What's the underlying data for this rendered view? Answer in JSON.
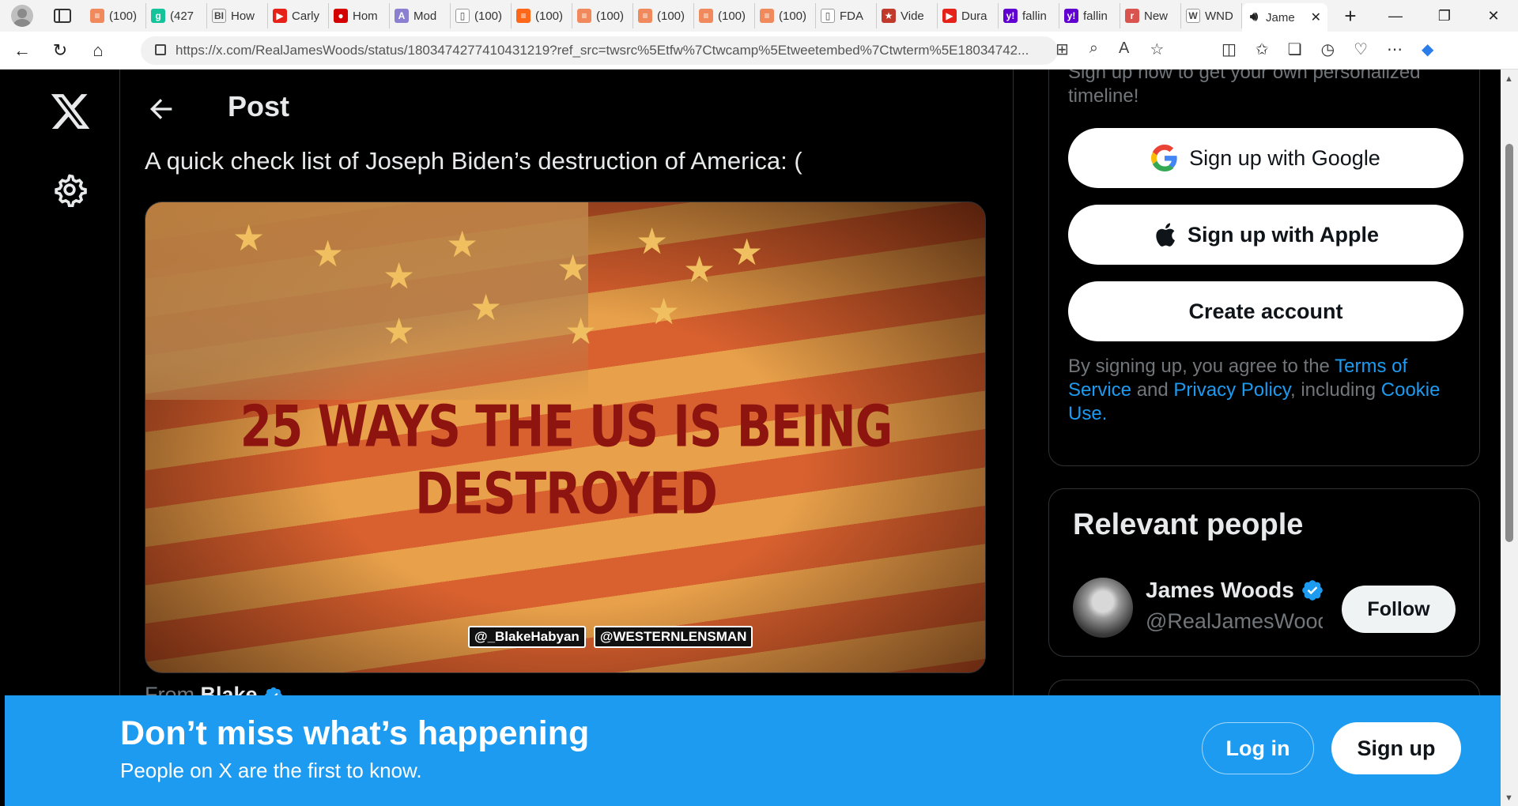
{
  "browser": {
    "tabs": [
      {
        "label": "(100)",
        "icon": "substack-icon",
        "color": "#f08a5d",
        "glyph": "≡"
      },
      {
        "label": "(427",
        "icon": "grammarly-icon",
        "color": "#15c39a",
        "glyph": "g"
      },
      {
        "label": "How",
        "icon": "bi-icon",
        "color": "#f2f2f2",
        "glyph": "BI"
      },
      {
        "label": "Carly",
        "icon": "youtube-icon",
        "color": "#e62117",
        "glyph": "▶"
      },
      {
        "label": "Hom",
        "icon": "red-logo-icon",
        "color": "#d40000",
        "glyph": "●"
      },
      {
        "label": "Mod",
        "icon": "ai-icon",
        "color": "#8a7fd0",
        "glyph": "A"
      },
      {
        "label": "(100)",
        "icon": "page-icon",
        "color": "#ffffff",
        "glyph": "▯"
      },
      {
        "label": "(100)",
        "icon": "substack-icon",
        "color": "#ff6719",
        "glyph": "≡"
      },
      {
        "label": "(100)",
        "icon": "substack-icon",
        "color": "#f08a5d",
        "glyph": "≡"
      },
      {
        "label": "(100)",
        "icon": "substack-icon",
        "color": "#f08a5d",
        "glyph": "≡"
      },
      {
        "label": "(100)",
        "icon": "substack-icon",
        "color": "#f08a5d",
        "glyph": "≡"
      },
      {
        "label": "(100)",
        "icon": "substack-icon",
        "color": "#f08a5d",
        "glyph": "≡"
      },
      {
        "label": "FDA",
        "icon": "page-icon",
        "color": "#ffffff",
        "glyph": "▯"
      },
      {
        "label": "Vide",
        "icon": "star-icon",
        "color": "#c0392b",
        "glyph": "★"
      },
      {
        "label": "Dura",
        "icon": "youtube-icon",
        "color": "#e62117",
        "glyph": "▶"
      },
      {
        "label": "fallin",
        "icon": "yahoo-icon",
        "color": "#6001d2",
        "glyph": "y!"
      },
      {
        "label": "fallin",
        "icon": "yahoo-icon",
        "color": "#6001d2",
        "glyph": "y!"
      },
      {
        "label": "New",
        "icon": "news-icon",
        "color": "#d9534f",
        "glyph": "r"
      },
      {
        "label": "WND",
        "icon": "wnd-icon",
        "color": "#ffffff",
        "glyph": "W"
      }
    ],
    "active_tab": {
      "label": "Jame",
      "icon": "audio-icon"
    },
    "url": "https://x.com/RealJamesWoods/status/1803474277410431219?ref_src=twsrc%5Etfw%7Ctwcamp%5Etweetembed%7Ctwterm%5E18034742..."
  },
  "header": {
    "title": "Post"
  },
  "tweet": {
    "text": "A quick check list of Joseph Biden’s destruction of America: (",
    "media_title": "25 WAYS THE US IS BEING DESTROYED",
    "credit_left": "@_BlakeHabyan",
    "credit_right": "@WESTERNLENSMAN",
    "from_label": "From",
    "from_name": "Blake"
  },
  "signup": {
    "faded_text": "Sign up now to get your own personalized timeline!",
    "google": "Sign up with Google",
    "apple": "Sign up with Apple",
    "create": "Create account",
    "terms_1": "By signing up, you agree to the ",
    "terms_link_1": "Terms of Service",
    "terms_2": " and ",
    "terms_link_2": "Privacy Policy",
    "terms_3": ", including ",
    "terms_link_3": "Cookie Use",
    "terms_4": "."
  },
  "relevant": {
    "title": "Relevant people",
    "name": "James Woods",
    "handle": "@RealJamesWoods",
    "follow": "Follow"
  },
  "banner": {
    "title": "Don’t miss what’s happening",
    "subtitle": "People on X are the first to know.",
    "login": "Log in",
    "signup": "Sign up"
  },
  "colors": {
    "accent": "#1d9bf0",
    "background": "#000000"
  }
}
